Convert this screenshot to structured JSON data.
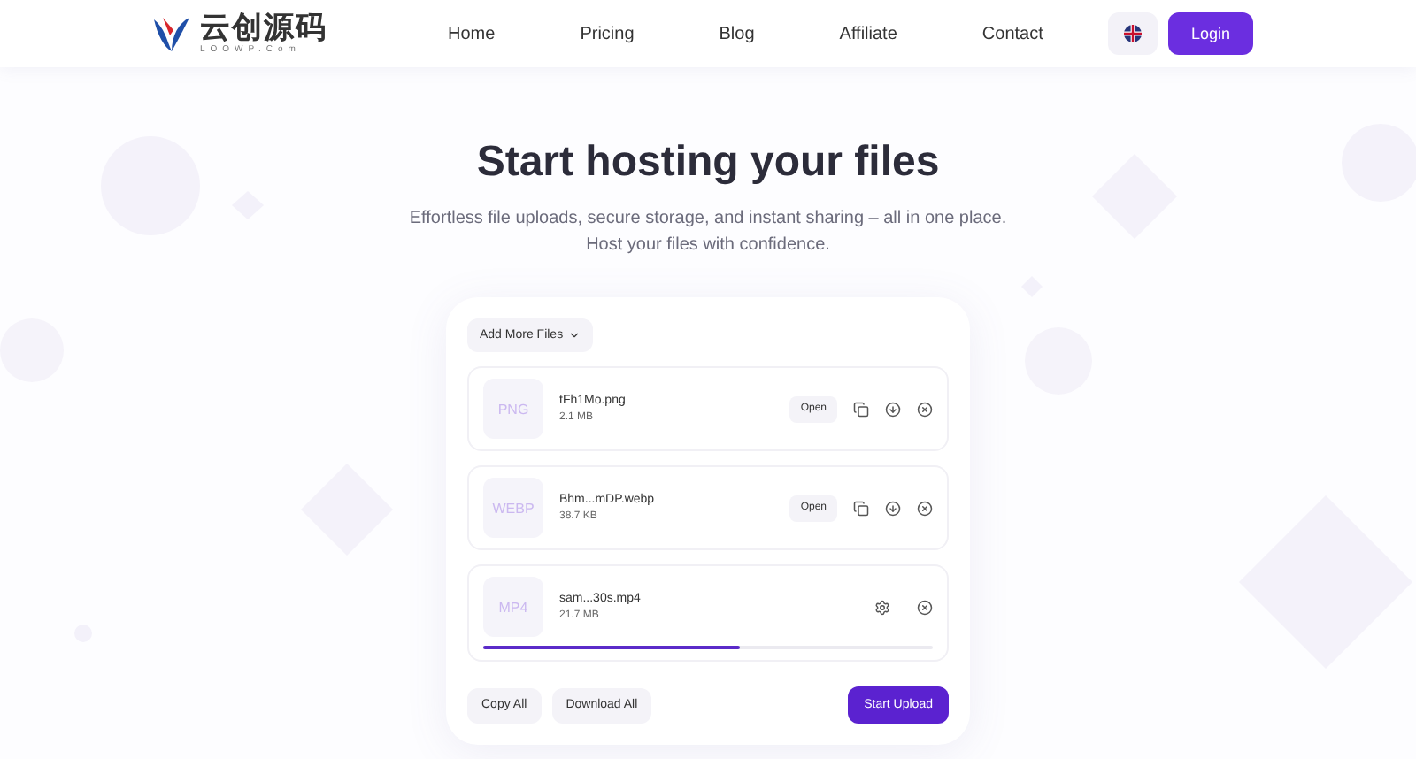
{
  "header": {
    "logo": {
      "name": "云创源码",
      "tagline": "LOOWP.Com"
    },
    "nav": [
      {
        "label": "Home"
      },
      {
        "label": "Pricing"
      },
      {
        "label": "Blog"
      },
      {
        "label": "Affiliate"
      },
      {
        "label": "Contact"
      }
    ],
    "login": "Login"
  },
  "hero": {
    "title": "Start hosting your files",
    "subtitle": "Effortless file uploads, secure storage, and instant sharing – all in one place. Host your files with confidence."
  },
  "uploader": {
    "add_button": "Add More Files",
    "files": [
      {
        "type": "PNG",
        "name": "tFh1Mo.png",
        "size": "2.1 MB",
        "kind": "done",
        "open": "Open"
      },
      {
        "type": "WEBP",
        "name": "Bhm...mDP.webp",
        "size": "38.7 KB",
        "kind": "done",
        "open": "Open"
      },
      {
        "type": "MP4",
        "name": "sam...30s.mp4",
        "size": "21.7 MB",
        "kind": "uploading",
        "level": 0.57
      }
    ],
    "copy_all": "Copy All",
    "download_all": "Download All",
    "start": "Start Upload"
  }
}
